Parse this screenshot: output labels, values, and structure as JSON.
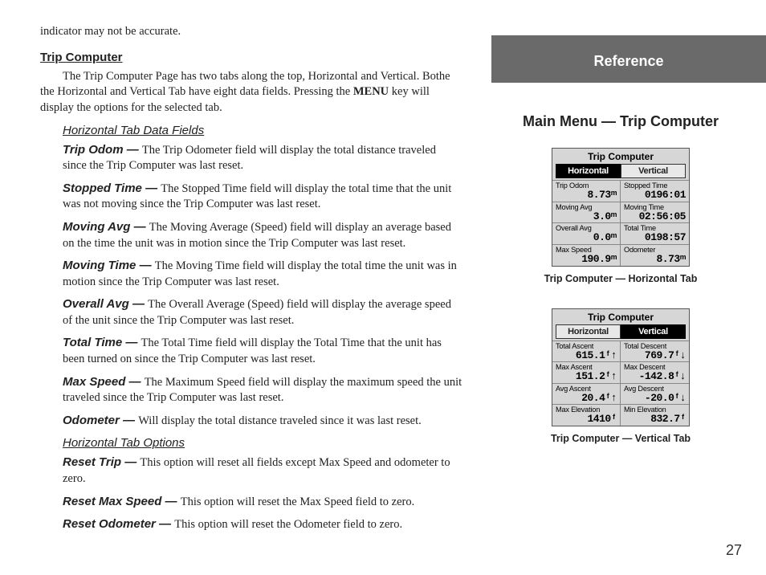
{
  "pageNumber": "27",
  "reference": "Reference",
  "subhead": "Main Menu — Trip Computer",
  "introFragment": "indicator may not be accurate.",
  "sectionTitle": "Trip Computer",
  "sectionIntro1": "The Trip Computer Page has two tabs along the top, Horizontal and Vertical. Bothe the Horizontal and Vertical Tab have eight data fields. Pressing the ",
  "menuKey": "MENU",
  "sectionIntro2": " key will display the options for the selected tab.",
  "hFieldsTitle": "Horizontal Tab Data Fields",
  "fields": [
    {
      "term": "Trip Odom — ",
      "desc": "The Trip Odometer field will display the total distance traveled since the Trip Computer was last reset."
    },
    {
      "term": "Stopped Time — ",
      "desc": "The Stopped Time field will display the total time that the unit was not moving since the Trip Computer was last reset."
    },
    {
      "term": "Moving Avg — ",
      "desc": "The Moving Average (Speed) field will display an average based on the time the unit was in motion since the Trip Computer was last reset."
    },
    {
      "term": "Moving Time — ",
      "desc": "The Moving Time field will display the total time the unit was in motion since the Trip Computer was last reset."
    },
    {
      "term": "Overall Avg — ",
      "desc": "The Overall Average (Speed) field will display the average speed of the unit since the Trip Computer was last reset."
    },
    {
      "term": "Total Time — ",
      "desc": "The Total Time field will display the Total Time that the unit has been turned on since the Trip Computer was last reset."
    },
    {
      "term": "Max Speed — ",
      "desc": " The Maximum Speed field will display the maximum speed the unit traveled since the Trip Computer was last reset."
    },
    {
      "term": "Odometer — ",
      "desc": "Will display the total distance traveled since it was last reset."
    }
  ],
  "hOptionsTitle": "Horizontal Tab Options",
  "options": [
    {
      "term": "Reset Trip — ",
      "desc": "This option will reset all fields except Max Speed and odometer to zero."
    },
    {
      "term": "Reset Max Speed — ",
      "desc": "This option will reset the Max Speed  field to zero."
    },
    {
      "term": "Reset Odometer — ",
      "desc": "This option will reset the Odometer field to zero."
    }
  ],
  "device1": {
    "title": "Trip Computer",
    "tabs": [
      "Horizontal",
      "Vertical"
    ],
    "activeTab": 0,
    "cells": [
      {
        "label": "Trip Odom",
        "value": "8.73ᵐ"
      },
      {
        "label": "Stopped Time",
        "value": "0196:01"
      },
      {
        "label": "Moving Avg",
        "value": "3.0ᵐ"
      },
      {
        "label": "Moving Time",
        "value": "02:56:05"
      },
      {
        "label": "Overall Avg",
        "value": "0.0ᵐ"
      },
      {
        "label": "Total Time",
        "value": "0198:57"
      },
      {
        "label": "Max Speed",
        "value": "190.9ᵐ"
      },
      {
        "label": "Odometer",
        "value": "8.73ᵐ"
      }
    ],
    "caption": "Trip Computer — Horizontal Tab"
  },
  "device2": {
    "title": "Trip Computer",
    "tabs": [
      "Horizontal",
      "Vertical"
    ],
    "activeTab": 1,
    "cells": [
      {
        "label": "Total Ascent",
        "value": "615.1ᶠ↑"
      },
      {
        "label": "Total Descent",
        "value": "769.7ᶠ↓"
      },
      {
        "label": "Max Ascent",
        "value": "151.2ᶠ↑"
      },
      {
        "label": "Max Descent",
        "value": "-142.8ᶠ↓"
      },
      {
        "label": "Avg Ascent",
        "value": "20.4ᶠ↑"
      },
      {
        "label": "Avg Descent",
        "value": "-20.0ᶠ↓"
      },
      {
        "label": "Max Elevation",
        "value": "1410ᶠ"
      },
      {
        "label": "Min Elevation",
        "value": "832.7ᶠ"
      }
    ],
    "caption": "Trip Computer — Vertical Tab"
  }
}
